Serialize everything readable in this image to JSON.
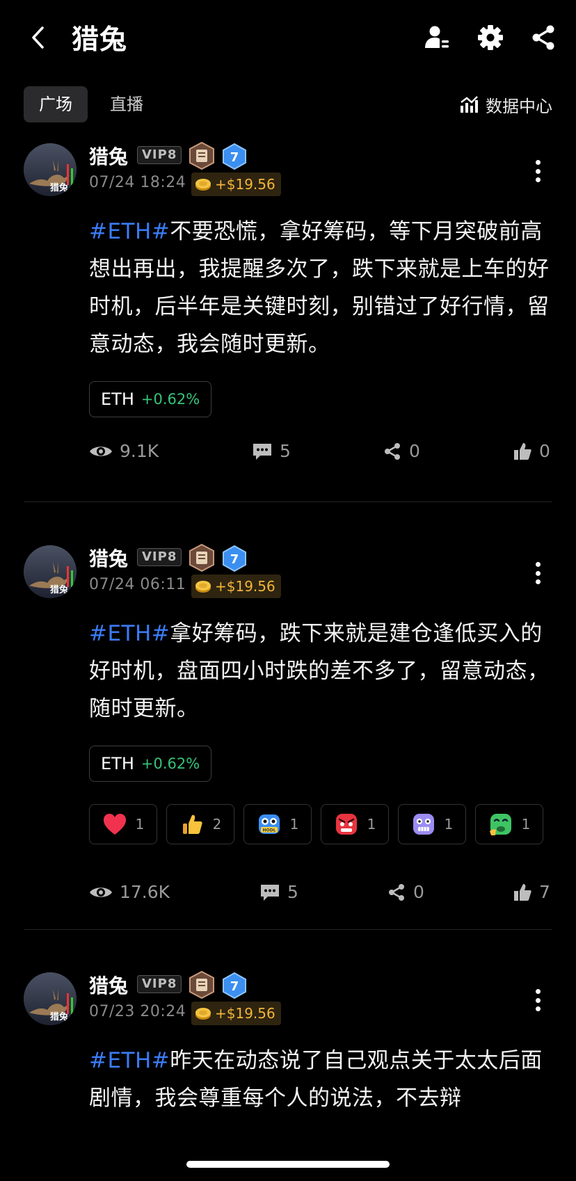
{
  "header": {
    "title": "猎兔",
    "icons": [
      "back-icon",
      "user-manage-icon",
      "settings-gear-icon",
      "share-icon"
    ]
  },
  "tabs": [
    {
      "label": "广场",
      "active": true
    },
    {
      "label": "直播",
      "active": false
    }
  ],
  "data_center": {
    "label": "数据中心",
    "icon": "chart-bars-icon"
  },
  "posts": [
    {
      "username": "猎兔",
      "vip": "VIP8",
      "level": "7",
      "time": "07/24 18:24",
      "reward": "+$19.56",
      "hashtag": "#ETH#",
      "text": "不要恐慌，拿好筹码，等下月突破前高想出再出，我提醒多次了，跌下来就是上车的好时机，后半年是关键时刻，别错过了好行情，留意动态，我会随时更新。",
      "ticker": {
        "symbol": "ETH",
        "change": "+0.62%"
      },
      "reactions": [],
      "stats": {
        "views": "9.1K",
        "comments": "5",
        "shares": "0",
        "likes": "0"
      }
    },
    {
      "username": "猎兔",
      "vip": "VIP8",
      "level": "7",
      "time": "07/24 06:11",
      "reward": "+$19.56",
      "hashtag": "#ETH#",
      "text": "拿好筹码，跌下来就是建仓逢低买入的好时机，盘面四小时跌的差不多了，留意动态，随时更新。",
      "ticker": {
        "symbol": "ETH",
        "change": "+0.62%"
      },
      "reactions": [
        {
          "emoji": "heart",
          "count": "1"
        },
        {
          "emoji": "thumbs-up",
          "count": "2"
        },
        {
          "emoji": "hodl-robot",
          "count": "1"
        },
        {
          "emoji": "angry-face",
          "count": "1"
        },
        {
          "emoji": "scared-face",
          "count": "1"
        },
        {
          "emoji": "sick-face",
          "count": "1"
        }
      ],
      "stats": {
        "views": "17.6K",
        "comments": "5",
        "shares": "0",
        "likes": "7"
      }
    },
    {
      "username": "猎兔",
      "vip": "VIP8",
      "level": "7",
      "time": "07/23 20:24",
      "reward": "+$19.56",
      "hashtag": "#ETH#",
      "text": "昨天在动态说了自己观点关于太太后面剧情，我会尊重每个人的说法，不去辩",
      "ticker": null,
      "reactions": [],
      "stats": null
    }
  ]
}
